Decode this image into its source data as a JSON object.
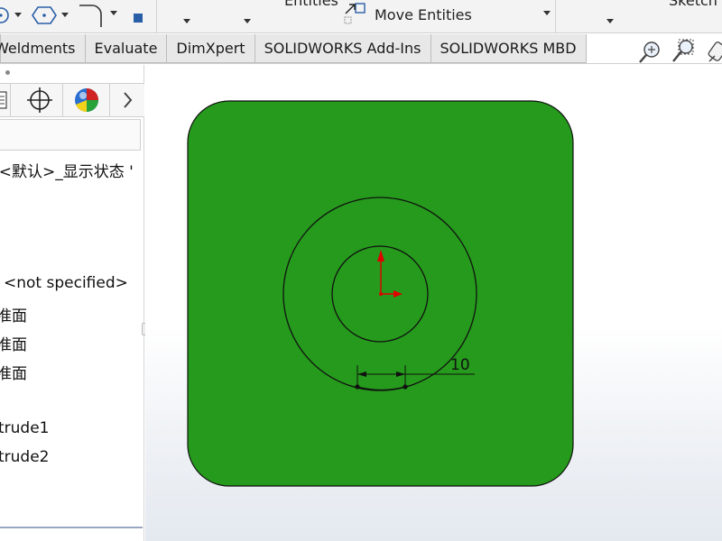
{
  "toolbar": {
    "entities_label": "Entities",
    "move_entities_label": "Move Entities",
    "sketch_label": "Sketch"
  },
  "tabs": [
    {
      "label": "Weldments"
    },
    {
      "label": "Evaluate"
    },
    {
      "label": "DimXpert"
    },
    {
      "label": "SOLIDWORKS Add-Ins"
    },
    {
      "label": "SOLIDWORKS MBD"
    }
  ],
  "tree": {
    "display_state": ":<默认>_显示状态 '",
    "material": "<not specified>",
    "plane_1": "准面",
    "plane_2": "准面",
    "plane_3": "准面",
    "extrude_1": "trude1",
    "extrude_2": "trude2"
  },
  "sketch": {
    "dimension_value": "10",
    "face_color": "#259a1c"
  }
}
